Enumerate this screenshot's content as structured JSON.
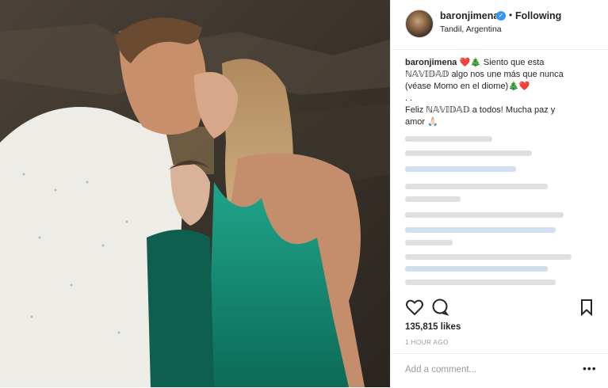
{
  "post": {
    "username": "baronjimena",
    "verified_icon": "verified-badge-icon",
    "separator": "•",
    "follow_label": "Following",
    "location": "Tandil, Argentina"
  },
  "caption": {
    "username": "baronjimena",
    "line1": "❤️🎄 Siento que esta",
    "line2": "ℕ𝔸𝕍𝕀𝔻𝔸𝔻 algo nos une más que nunca",
    "line3": "(véase Momo en el diome)🎄❤️",
    "line4": ". .",
    "line5": "Feliz ℕ𝔸𝕍𝕀𝔻𝔸𝔻 a todos! Mucha paz y",
    "line6": "amor 🙏🏻"
  },
  "stats": {
    "likes": "135,815 likes",
    "time": "1 HOUR AGO"
  },
  "comment_box": {
    "placeholder": "Add a comment...",
    "more": "•••"
  },
  "icons": [
    "heart-icon",
    "comment-icon",
    "bookmark-icon",
    "more-options-icon"
  ]
}
